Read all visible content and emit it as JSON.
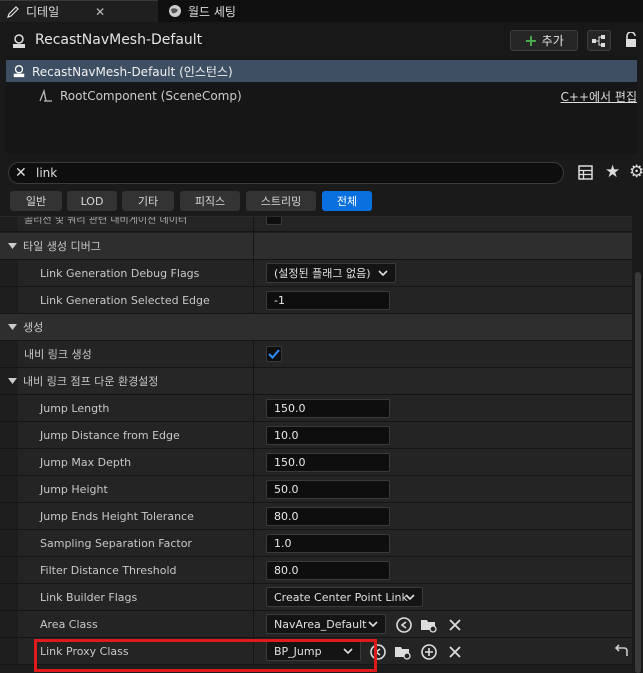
{
  "tabs": [
    {
      "label": "디테일",
      "icon": "pencil-icon"
    },
    {
      "label": "월드 세팅",
      "icon": "globe-icon"
    }
  ],
  "object": {
    "title": "RecastNavMesh-Default",
    "add_label": "추가"
  },
  "components": {
    "root": "RecastNavMesh-Default (인스턴스)",
    "child": "RootComponent (SceneComp)",
    "edit_link": "C++에서 편집"
  },
  "search": {
    "value": "link"
  },
  "filters": [
    "일반",
    "LOD",
    "기타",
    "피직스",
    "스트리밍",
    "전체"
  ],
  "active_filter": "전체",
  "properties": {
    "cut_label": "콜리전 및 쿼리 관련 내비게이션 데이터",
    "cat_debug": "타일 생성 디버그",
    "debug_flags_label": "Link Generation Debug Flags",
    "debug_flags_value": "(설정된 플래그 없음)",
    "selected_edge_label": "Link Generation Selected Edge",
    "selected_edge_value": "-1",
    "cat_gen": "생성",
    "gen_navlinks_label": "내비 링크 생성",
    "gen_navlinks_checked": true,
    "cat_jump": "내비 링크 점프 다운 환경설정",
    "jump_length_label": "Jump Length",
    "jump_length_value": "150.0",
    "jump_dist_label": "Jump Distance from Edge",
    "jump_dist_value": "10.0",
    "jump_max_label": "Jump Max Depth",
    "jump_max_value": "150.0",
    "jump_height_label": "Jump Height",
    "jump_height_value": "50.0",
    "jump_tol_label": "Jump Ends Height Tolerance",
    "jump_tol_value": "80.0",
    "sampling_label": "Sampling Separation Factor",
    "sampling_value": "1.0",
    "filter_label": "Filter Distance Threshold",
    "filter_value": "80.0",
    "builder_label": "Link Builder Flags",
    "builder_value": "Create Center Point Link",
    "area_label": "Area Class",
    "area_value": "NavArea_Default",
    "proxy_label": "Link Proxy Class",
    "proxy_value": "BP_Jump"
  },
  "colors": {
    "accent": "#0a70e0",
    "highlight": "#e01a1a",
    "selection": "#3f4f63",
    "add_icon": "#4caf50"
  }
}
